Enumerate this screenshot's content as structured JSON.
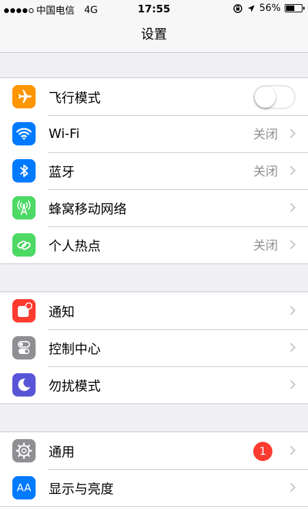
{
  "status_bar": {
    "carrier": "中国电信",
    "network": "4G",
    "time": "17:55",
    "battery": "56%",
    "battery_fraction": 0.56,
    "signal_bars_filled": 4,
    "signal_bars_total": 5
  },
  "nav": {
    "title": "设置"
  },
  "groups": [
    {
      "items": [
        {
          "label": "飞行模式",
          "icon": "airplane-icon",
          "icon_color": "#ff9500",
          "control": "toggle",
          "toggle_on": false
        },
        {
          "label": "Wi-Fi",
          "icon": "wifi-icon",
          "icon_color": "#007aff",
          "value": "关闭"
        },
        {
          "label": "蓝牙",
          "icon": "bluetooth-icon",
          "icon_color": "#007aff",
          "value": "关闭"
        },
        {
          "label": "蜂窝移动网络",
          "icon": "antenna-icon",
          "icon_color": "#4cd964"
        },
        {
          "label": "个人热点",
          "icon": "hotspot-link-icon",
          "icon_color": "#4cd964",
          "value": "关闭"
        }
      ]
    },
    {
      "items": [
        {
          "label": "通知",
          "icon": "notification-icon",
          "icon_color": "#ff3b30"
        },
        {
          "label": "控制中心",
          "icon": "control-center-icon",
          "icon_color": "#8e8e93"
        },
        {
          "label": "勿扰模式",
          "icon": "moon-icon",
          "icon_color": "#5856d6"
        }
      ]
    },
    {
      "items": [
        {
          "label": "通用",
          "icon": "gear-icon",
          "icon_color": "#8e8e93",
          "badge": "1"
        },
        {
          "label": "显示与亮度",
          "icon": "display-brightness-icon",
          "icon_color": "#007aff",
          "icon_text": "AA"
        }
      ]
    }
  ]
}
